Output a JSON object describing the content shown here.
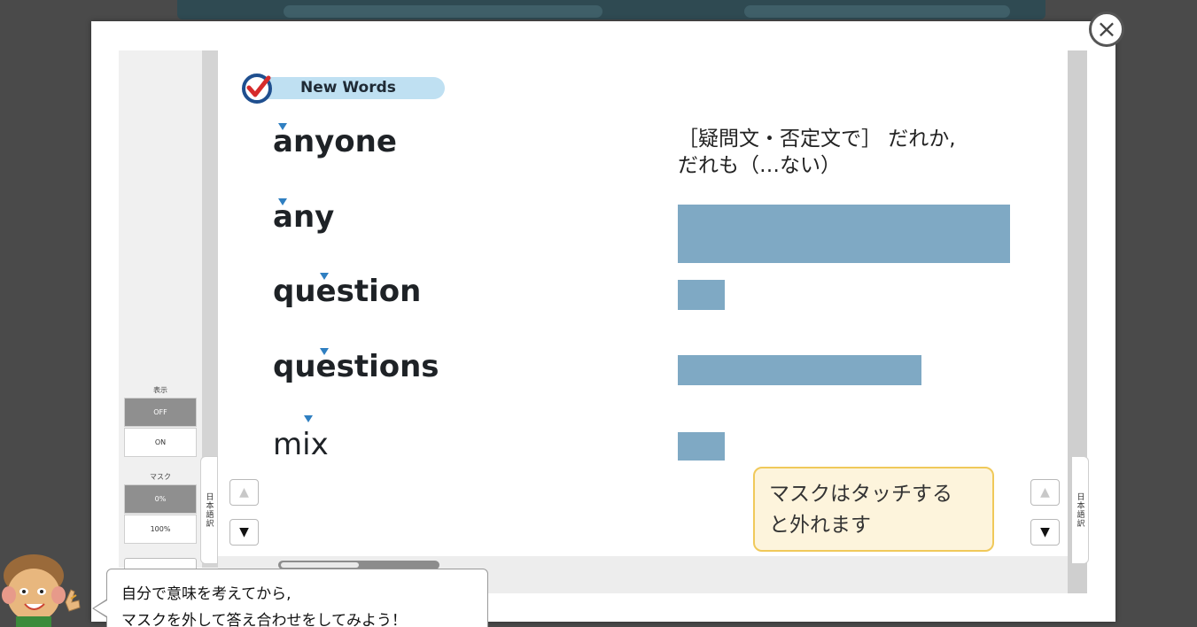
{
  "header": {
    "title": "New Words"
  },
  "words": [
    {
      "term": "anyone",
      "meaning_line1": "［疑問文・否定文で］ だれか,",
      "meaning_line2": "だれも（…ない）",
      "masked": false
    },
    {
      "term": "any",
      "masked": true
    },
    {
      "term": "question",
      "masked": true
    },
    {
      "term": "questions",
      "masked": true
    },
    {
      "term": "mix",
      "masked": true
    }
  ],
  "controls": {
    "display": {
      "label": "表示",
      "off": "OFF",
      "on": "ON",
      "selected": "OFF"
    },
    "mask": {
      "label": "マスク",
      "zero": "0%",
      "full": "100%",
      "selected": "0%"
    },
    "side_tab_label": "日本語訳"
  },
  "tooltip": {
    "line1": "マスクはタッチする",
    "line2": "と外れます"
  },
  "speech": {
    "line1": "自分で意味を考えてから,",
    "line2": "マスクを外して答え合わせをしてみよう！"
  },
  "buttons": {
    "close": "×",
    "up": "▲",
    "down": "▼"
  },
  "colors": {
    "mask": "#7fa9c4",
    "stress_mark": "#2f7fc1",
    "header_pill": "#bfe0f2",
    "tooltip_border": "#f0c95a"
  }
}
